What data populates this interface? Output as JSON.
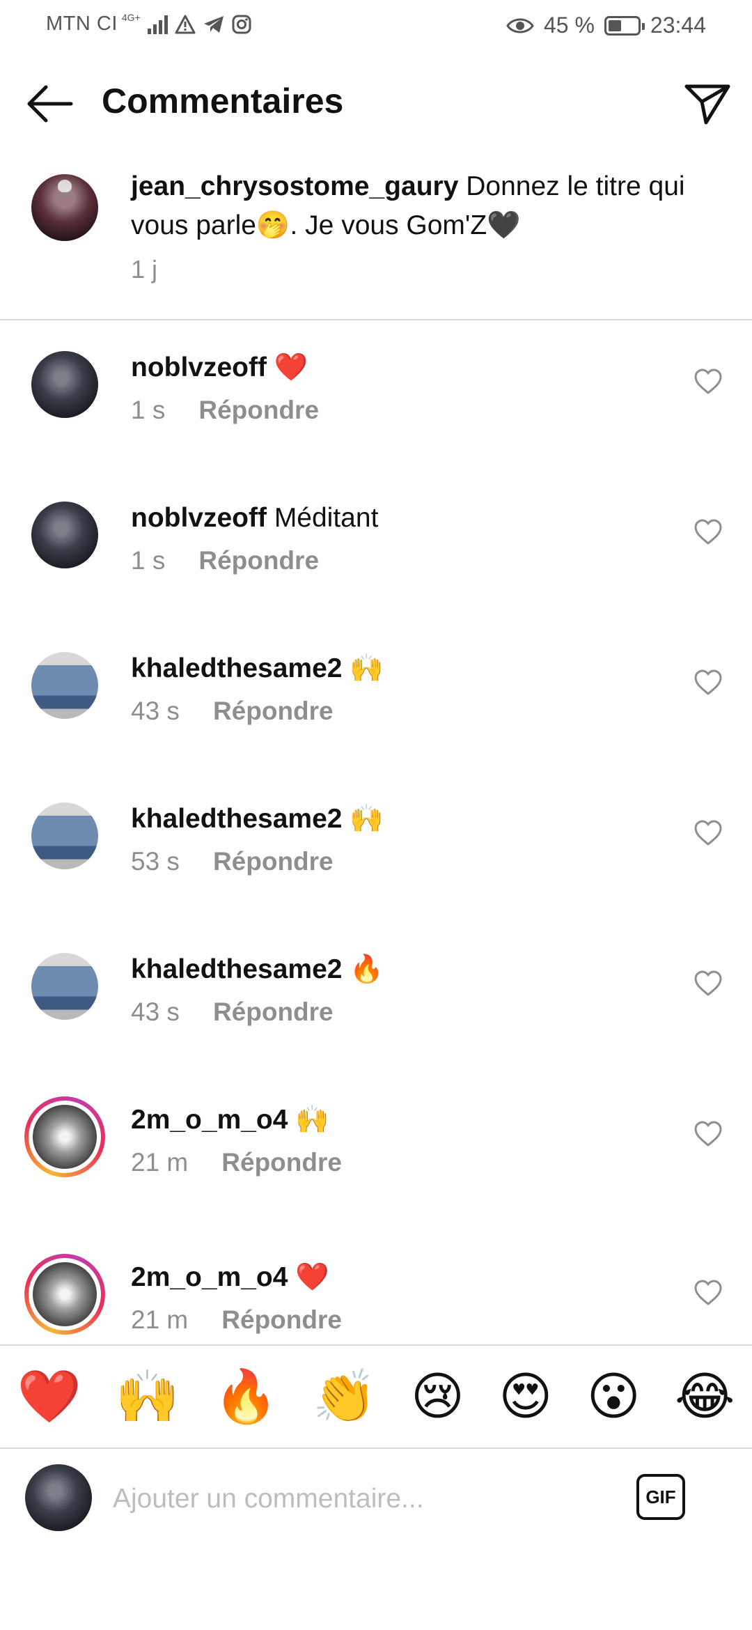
{
  "status_bar": {
    "carrier": "MTN CI",
    "network": "4G+",
    "battery": "45 %",
    "battery_level": 0.45,
    "time": "23:44"
  },
  "header": {
    "title": "Commentaires",
    "back_icon": "arrow-left-icon",
    "share_icon": "send-icon"
  },
  "caption": {
    "username": "jean_chrysostome_gaury",
    "text": " Donnez le titre qui vous parle🤭. Je vous Gom'Z🖤",
    "time": "1 j"
  },
  "comments": [
    {
      "username": "noblvzeoff",
      "text": " ❤️",
      "time": "1 s",
      "reply": "Répondre"
    },
    {
      "username": "noblvzeoff",
      "text": " Méditant",
      "time": "1 s",
      "reply": "Répondre"
    },
    {
      "username": "khaledthesame2",
      "text": " 🙌",
      "time": "43 s",
      "reply": "Répondre"
    },
    {
      "username": "khaledthesame2",
      "text": " 🙌",
      "time": "53 s",
      "reply": "Répondre"
    },
    {
      "username": "khaledthesame2",
      "text": " 🔥",
      "time": "43 s",
      "reply": "Répondre"
    },
    {
      "username": "2m_o_m_o4",
      "text": " 🙌",
      "time": "21 m",
      "reply": "Répondre"
    },
    {
      "username": "2m_o_m_o4",
      "text": " ❤️",
      "time": "21 m",
      "reply": "Répondre"
    }
  ],
  "reactions": [
    "❤️",
    "🙌",
    "🔥",
    "👏",
    "😢",
    "😍",
    "😮",
    "😂"
  ],
  "composer": {
    "placeholder": "Ajouter un commentaire...",
    "gif_label": "GIF"
  }
}
